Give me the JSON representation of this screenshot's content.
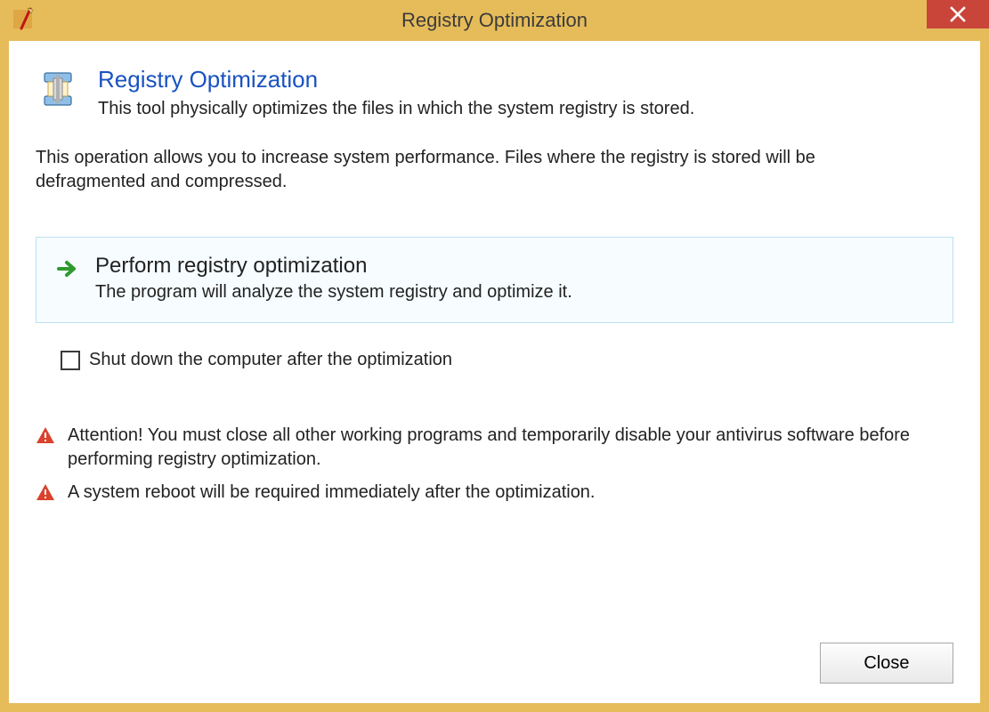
{
  "window": {
    "title": "Registry Optimization"
  },
  "header": {
    "title": "Registry Optimization",
    "subtitle": "This tool physically optimizes the files in which the system registry is stored."
  },
  "description": "This operation allows you to increase system performance. Files where the registry is stored will be defragmented and compressed.",
  "action": {
    "title": "Perform registry optimization",
    "subtitle": "The program will analyze the system registry and optimize it."
  },
  "shutdown_checkbox": {
    "checked": false,
    "label": "Shut down the computer after the optimization"
  },
  "warnings": [
    "Attention! You must close all other working programs and temporarily disable your antivirus software before performing registry optimization.",
    "A system reboot will be required immediately after the optimization."
  ],
  "buttons": {
    "close": "Close"
  },
  "colors": {
    "frame": "#e6bc5a",
    "close": "#c9453a",
    "heading": "#1a52c0",
    "action_border": "#bfe0f0",
    "warning": "#d9432e"
  }
}
